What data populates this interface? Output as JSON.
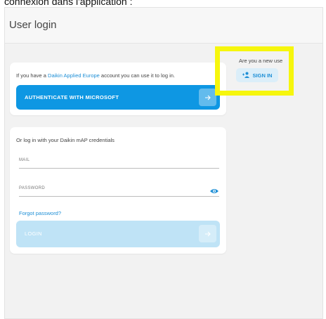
{
  "caption": "connexion dans l'application :",
  "header": {
    "title": "User login"
  },
  "microsoft": {
    "intro_before": "If you have a ",
    "intro_link": "Daikin Applied Europe",
    "intro_after": " account you can use it to log in.",
    "button_label": "AUTHENTICATE WITH MICROSOFT"
  },
  "credentials": {
    "title": "Or log in with your Daikin mAP credentials",
    "mail_label": "MAIL",
    "password_label": "PASSWORD",
    "forgot_label": "Forgot password?",
    "login_label": "LOGIN"
  },
  "new_user": {
    "question": "Are you a new use",
    "signin_label": "SIGN IN"
  },
  "colors": {
    "primary": "#0e97e3",
    "primary_disabled": "#bfe3f6",
    "link": "#1e8fd6",
    "highlight": "#f6f60d"
  }
}
